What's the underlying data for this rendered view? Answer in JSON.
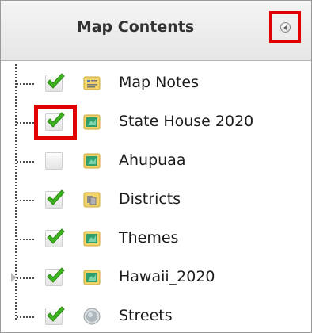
{
  "panel": {
    "title": "Map Contents",
    "collapse_button": {
      "icon": "collapse-left-icon"
    }
  },
  "layers": [
    {
      "label": "Map Notes",
      "checked": true,
      "icon": "map-notes-icon"
    },
    {
      "label": "State House 2020",
      "checked": true,
      "icon": "feature-layer-icon",
      "highlighted": true
    },
    {
      "label": "Ahupuaa",
      "checked": false,
      "icon": "feature-layer-icon"
    },
    {
      "label": "Districts",
      "checked": true,
      "icon": "group-layer-icon"
    },
    {
      "label": "Themes",
      "checked": true,
      "icon": "feature-layer-icon"
    },
    {
      "label": "Hawaii_2020",
      "checked": true,
      "icon": "feature-layer-icon",
      "expandable": true
    },
    {
      "label": "Streets",
      "checked": true,
      "icon": "basemap-globe-icon"
    }
  ],
  "colors": {
    "highlight": "#e00000",
    "check_green": "#3cb31f",
    "layer_icon_green": "#2f9f6e",
    "folder_yellow": "#f2d46a"
  }
}
